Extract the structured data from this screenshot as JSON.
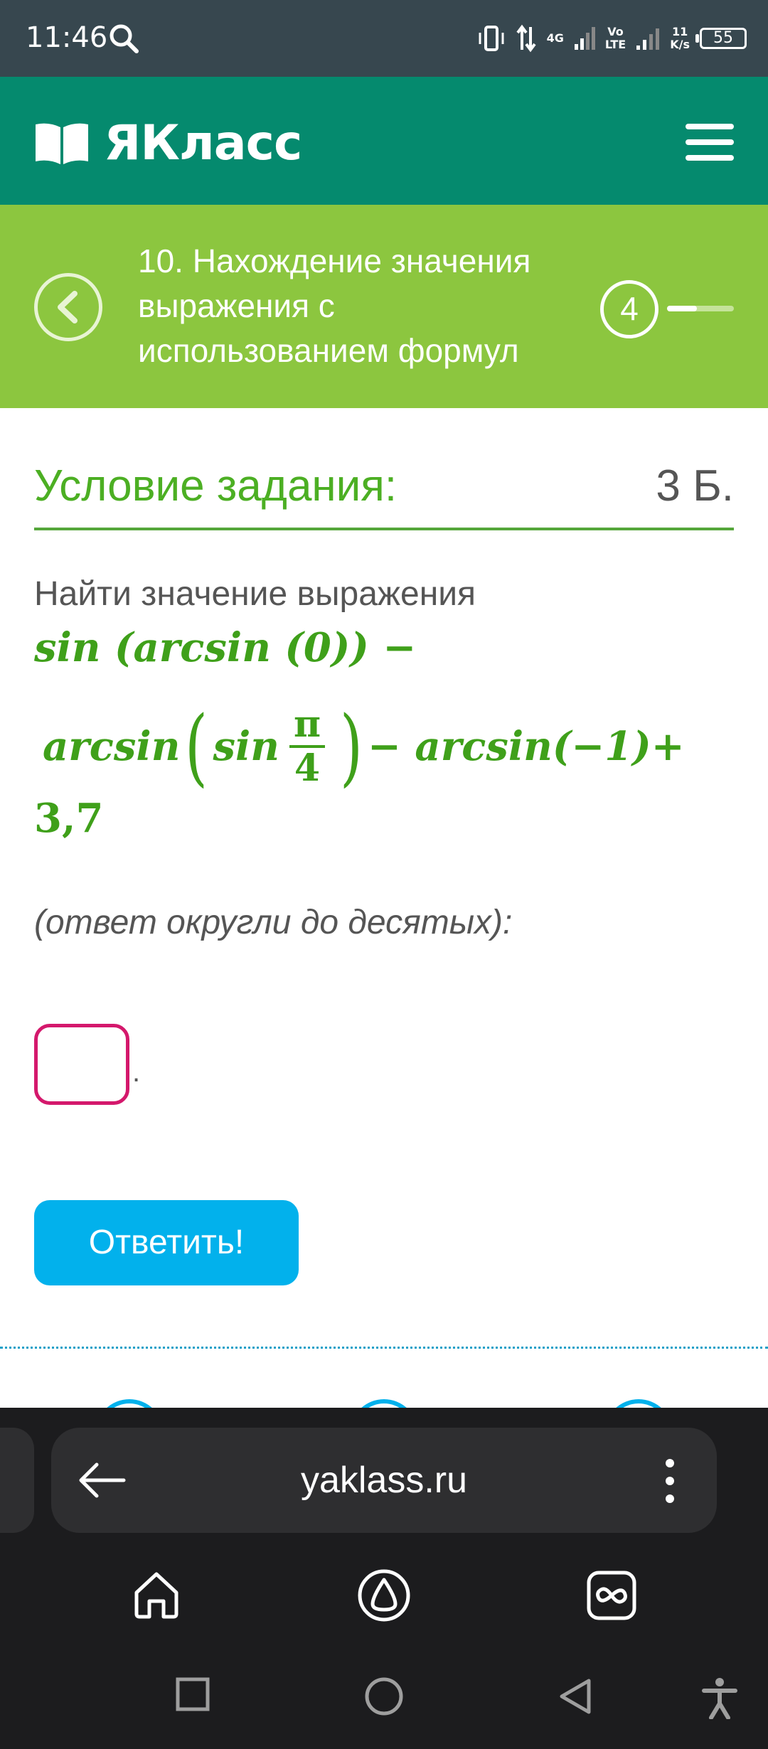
{
  "status_bar": {
    "time": "11:46",
    "network_4g": "4G",
    "volte": "Vo\nLTE",
    "speed": "11\nK/s",
    "battery": "55"
  },
  "header": {
    "logo_text": "ЯКласс"
  },
  "topic": {
    "title": "10. Нахождение значения выражения с использованием формул",
    "step": "4",
    "progress": 0.45
  },
  "task": {
    "heading": "Условие задания:",
    "points": "3 Б.",
    "prompt": "Найти значение выражения",
    "math_line1": "sin (arcsin (0)) −",
    "math_line2": {
      "arcsin": "arcsin",
      "open": "(",
      "sin": "sin",
      "frac_num": "π",
      "frac_den": "4",
      "close": ")",
      "rest": "− arcsin(−1)+"
    },
    "math_line3": "3,7",
    "hint": "(ответ округли до десятых):",
    "answer_suffix": ".",
    "submit_label": "Ответить!"
  },
  "browser": {
    "url": "yaklass.ru"
  },
  "colors": {
    "header_bg": "#058a6e",
    "topic_bg": "#8cc63f",
    "accent_green": "#4caf23",
    "input_border": "#d4186c",
    "button_bg": "#02b1ec"
  }
}
